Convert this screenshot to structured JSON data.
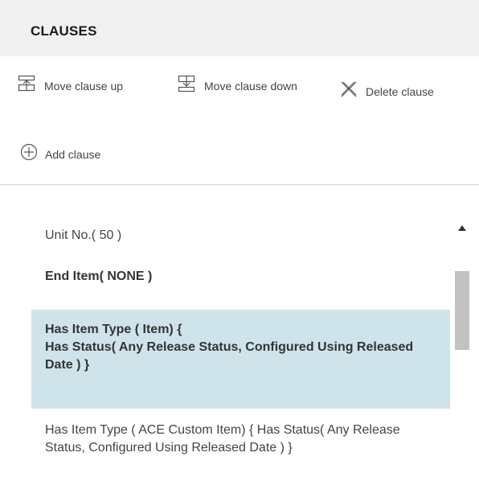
{
  "panel": {
    "title": "CLAUSES"
  },
  "toolbar": {
    "move_up_label": "Move clause up",
    "move_down_label": "Move clause down",
    "delete_label": "Delete clause",
    "add_label": "Add clause",
    "icons": {
      "move_up": "move-up-icon",
      "move_down": "move-down-icon",
      "delete": "delete-icon",
      "add": "add-circle-icon"
    }
  },
  "clauses": [
    {
      "text": "Unit No.( 50 )",
      "bold": false,
      "selected": false
    },
    {
      "text": "End Item( NONE )",
      "bold": true,
      "selected": false
    },
    {
      "text": "Has Item Type ( Item) {\nHas Status( Any Release Status, Configured Using Released Date ) }",
      "line1": "Has Item Type ( Item) {",
      "line2": "Has Status( Any Release Status, Configured Using Released Date ) }",
      "bold": true,
      "selected": true
    },
    {
      "text": "Has Item Type ( ACE Custom Item) { Has Status( Any Release Status, Configured Using Released Date ) }",
      "bold": false,
      "selected": false
    }
  ],
  "colors": {
    "header_bg": "#f0f0f0",
    "selected_bg": "#cfe3ea",
    "scroll_thumb": "#c2c2c2"
  }
}
